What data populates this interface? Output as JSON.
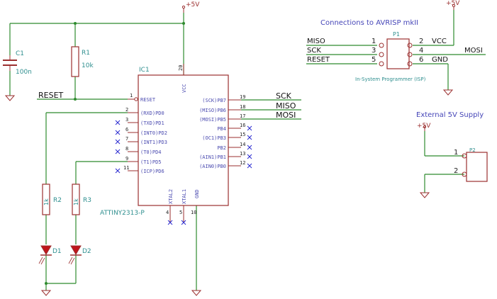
{
  "colors": {
    "wire": "#2e8b2e",
    "body": "#9b2f2f",
    "pin": "#9b2f2f",
    "ref": "#2f8f8f",
    "pinText": "#4b4bb0",
    "nc": "#2a2ad0",
    "led": "#c0151a",
    "net": "#111111",
    "title": "#4646b8"
  },
  "power": {
    "vcc_top": "+5V",
    "vcc_isp": "+5V",
    "vcc_ext": "+5V"
  },
  "c1": {
    "ref": "C1",
    "value": "100n"
  },
  "r1": {
    "ref": "R1",
    "value": "10k"
  },
  "r2": {
    "ref": "R2",
    "value": "1k"
  },
  "r3": {
    "ref": "R3",
    "value": "1k"
  },
  "d1": {
    "ref": "D1"
  },
  "d2": {
    "ref": "D2"
  },
  "ic1": {
    "ref": "IC1",
    "part": "ATTINY2313-P",
    "left_pins": [
      {
        "num": "1",
        "name": "RESET"
      },
      {
        "num": "2",
        "name": "(RXD)PD0"
      },
      {
        "num": "3",
        "name": "(TXD)PD1"
      },
      {
        "num": "6",
        "name": "(INT0)PD2"
      },
      {
        "num": "7",
        "name": "(INT1)PD3"
      },
      {
        "num": "8",
        "name": "(T0)PD4"
      },
      {
        "num": "9",
        "name": "(T1)PD5"
      },
      {
        "num": "11",
        "name": "(ICP)PD6"
      }
    ],
    "right_pins": [
      {
        "num": "19",
        "name": "(SCK)PB7"
      },
      {
        "num": "18",
        "name": "(MISO)PB6"
      },
      {
        "num": "17",
        "name": "(MOSI)PB5"
      },
      {
        "num": "16",
        "name": "PB4"
      },
      {
        "num": "15",
        "name": "(OC1)PB3"
      },
      {
        "num": "14",
        "name": "PB2"
      },
      {
        "num": "13",
        "name": "(AIN1)PB1"
      },
      {
        "num": "12",
        "name": "(AIN0)PB0"
      }
    ],
    "vcc_pin": {
      "num": "20",
      "name": "VCC"
    },
    "bottom_pins": [
      {
        "num": "4",
        "name": "XTAL2"
      },
      {
        "num": "5",
        "name": "XTAL1"
      },
      {
        "num": "10",
        "name": "GND"
      }
    ]
  },
  "nets": {
    "reset": "RESET",
    "sck": "SCK",
    "miso": "MISO",
    "mosi": "MOSI"
  },
  "isp": {
    "title": "Connections to AVRISP mkII",
    "ref": "P1",
    "subtitle": "In-System Programmer (ISP)",
    "left": [
      {
        "net": "MISO",
        "num": "1"
      },
      {
        "net": "SCK",
        "num": "3"
      },
      {
        "net": "RESET",
        "num": "5"
      }
    ],
    "right": [
      {
        "num": "2",
        "net": "VCC"
      },
      {
        "num": "4",
        "net": "MOSI"
      },
      {
        "num": "6",
        "net": "GND"
      }
    ]
  },
  "ext": {
    "title": "External 5V Supply",
    "ref": "P2",
    "pin1": "1",
    "pin2": "2"
  }
}
